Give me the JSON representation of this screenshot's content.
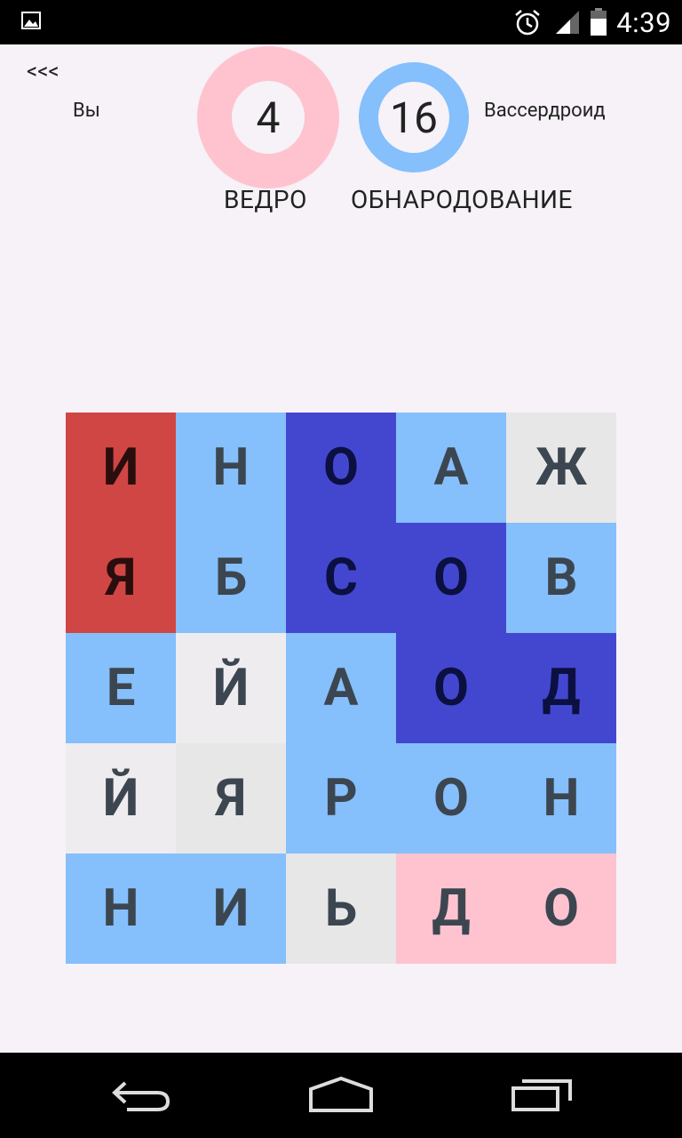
{
  "status": {
    "time": "4:39"
  },
  "header": {
    "back_label": "<<<",
    "you_label": "Вы",
    "opponent_label": "Вассердроид",
    "you_score": "4",
    "opponent_score": "16",
    "you_word": "ВЕДРО",
    "opponent_word": "ОБНАРОДОВАНИЕ",
    "you_color": "#ffc3d0",
    "opponent_color": "#85bffc"
  },
  "board": {
    "rows": [
      [
        {
          "letter": "И",
          "state": "you-locked"
        },
        {
          "letter": "Н",
          "state": "opponent"
        },
        {
          "letter": "О",
          "state": "opponent-locked"
        },
        {
          "letter": "А",
          "state": "opponent"
        },
        {
          "letter": "Ж",
          "state": "neutral"
        }
      ],
      [
        {
          "letter": "Я",
          "state": "you-locked"
        },
        {
          "letter": "Б",
          "state": "opponent"
        },
        {
          "letter": "С",
          "state": "opponent-locked"
        },
        {
          "letter": "О",
          "state": "opponent-locked"
        },
        {
          "letter": "В",
          "state": "opponent"
        }
      ],
      [
        {
          "letter": "Е",
          "state": "opponent"
        },
        {
          "letter": "Й",
          "state": "neutral-light"
        },
        {
          "letter": "А",
          "state": "opponent"
        },
        {
          "letter": "О",
          "state": "opponent-locked"
        },
        {
          "letter": "Д",
          "state": "opponent-locked"
        }
      ],
      [
        {
          "letter": "Й",
          "state": "neutral-light"
        },
        {
          "letter": "Я",
          "state": "neutral"
        },
        {
          "letter": "Р",
          "state": "opponent"
        },
        {
          "letter": "О",
          "state": "opponent"
        },
        {
          "letter": "Н",
          "state": "opponent"
        }
      ],
      [
        {
          "letter": "Н",
          "state": "opponent"
        },
        {
          "letter": "И",
          "state": "opponent"
        },
        {
          "letter": "Ь",
          "state": "neutral"
        },
        {
          "letter": "Д",
          "state": "you"
        },
        {
          "letter": "О",
          "state": "you"
        }
      ]
    ],
    "colors": {
      "you": "#ffc3d0",
      "you-locked": "#d04644",
      "opponent": "#85bffc",
      "opponent-locked": "#4347d0",
      "neutral": "#e7e7e7",
      "neutral-light": "#efecef"
    },
    "text_colors": {
      "you-locked": "#2a0e0e",
      "opponent-locked": "#0c1040",
      "default": "#3c4650"
    }
  }
}
